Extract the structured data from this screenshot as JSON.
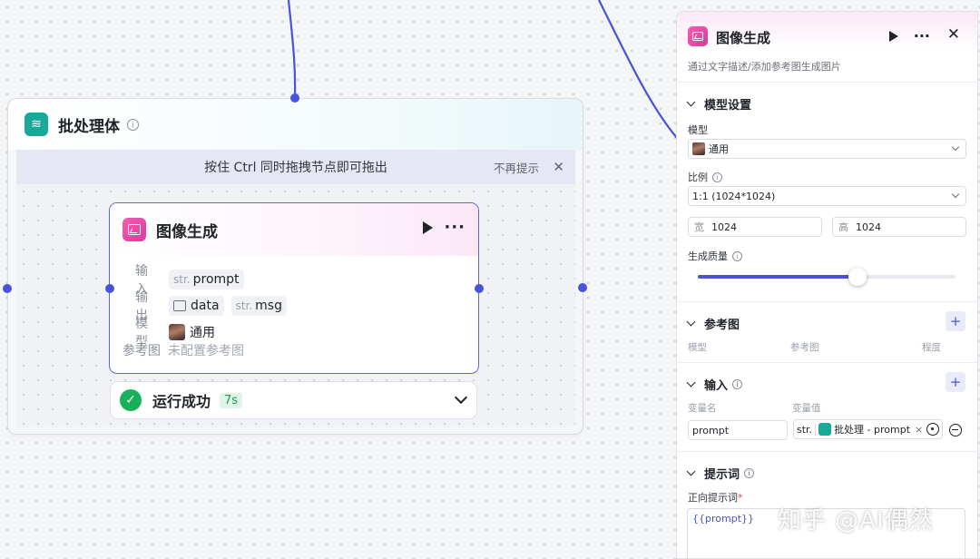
{
  "canvas": {
    "batch": {
      "title": "批处理体",
      "hint": "按住 Ctrl 同时拖拽节点即可拖出",
      "hint_dismiss": "不再提示",
      "hint_close": "✕"
    },
    "image_node": {
      "title": "图像生成",
      "more": "···",
      "input_label": "输入",
      "input_type": "str.",
      "input_name": "prompt",
      "output_label": "输出",
      "output_1_name": "data",
      "output_2_type": "str.",
      "output_2_name": "msg",
      "model_label": "模型",
      "model_name": "通用",
      "ref_label": "参考图",
      "ref_value": "未配置参考图"
    },
    "run_status": {
      "text": "运行成功",
      "duration": "7s",
      "icon": "check-circle-icon",
      "color": "#18b058"
    }
  },
  "panel": {
    "title": "图像生成",
    "more": "···",
    "close": "✕",
    "description": "通过文字描述/添加参考图生成图片",
    "model_section": {
      "title": "模型设置",
      "model_label": "模型",
      "model_value": "通用",
      "ratio_label": "比例",
      "ratio_value": "1:1 (1024*1024)",
      "width_prefix": "宽",
      "width_value": "1024",
      "height_prefix": "高",
      "height_value": "1024",
      "quality_label": "生成质量",
      "quality_level": 0.62
    },
    "ref_section": {
      "title": "参考图",
      "add": "+",
      "columns": [
        "模型",
        "参考图",
        "程度"
      ]
    },
    "input_section": {
      "title": "输入",
      "add": "+",
      "col_name": "变量名",
      "col_value": "变量值",
      "var_name": "prompt",
      "var_type": "str.",
      "var_ref": "批处理 - prompt",
      "var_remove": "×"
    },
    "prompt_section": {
      "title": "提示词",
      "positive_label": "正向提示词",
      "required_mark": "*",
      "positive_value": "{{prompt}}"
    }
  },
  "watermark": "知乎 @AI偶然",
  "colors": {
    "accent": "#4a52d9",
    "teal": "#18a999",
    "pink": "#e84aab"
  }
}
